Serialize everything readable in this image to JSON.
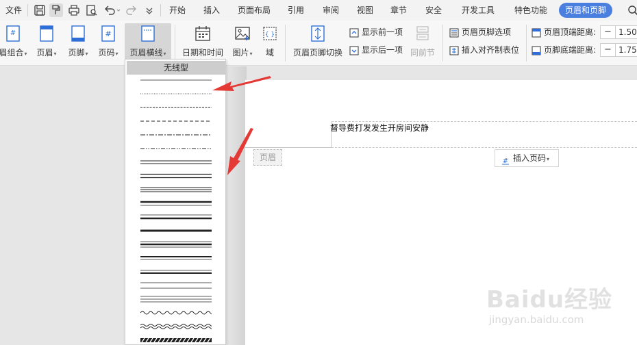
{
  "menubar": {
    "file": "文件",
    "tabs": [
      "开始",
      "插入",
      "页面布局",
      "引用",
      "审阅",
      "视图",
      "章节",
      "安全",
      "开发工具",
      "特色功能"
    ],
    "active_tab": "页眉和页脚"
  },
  "ribbon": {
    "combo": "眉组合",
    "header": "页眉",
    "footer": "页脚",
    "page_number": "页码",
    "header_line": "页眉横线",
    "datetime": "日期和时间",
    "picture": "图片",
    "field": "域",
    "switch": "页眉页脚切换",
    "show_prev": "显示前一项",
    "show_next": "显示后一项",
    "same_as_prev": "同前节",
    "hf_options": "页眉页脚选项",
    "insert_align_tab": "插入对齐制表位",
    "header_top_label": "页眉顶端距离:",
    "header_top_value": "1.50",
    "footer_bottom_label": "页脚底端距离:",
    "footer_bottom_value": "1.75"
  },
  "dropdown": {
    "title": "无线型",
    "styles": [
      "thin-solid",
      "dotted-fine",
      "dashed-fine",
      "dashed",
      "dash-dot",
      "dash-dot-dot",
      "double-thin",
      "double",
      "triple",
      "thick-thin",
      "thin-thick",
      "thick",
      "thin-thick-thin",
      "thick-thin-small",
      "thin-thick-small",
      "spaced-double",
      "triple-thin",
      "wave",
      "double-wave",
      "hatched"
    ]
  },
  "document": {
    "header_text": "督导费打发发生开房间安静",
    "header_tag": "页眉",
    "insert_page_number": "插入页码"
  },
  "watermark": {
    "brand": "Baidu经验",
    "url": "jingyan.baidu.com"
  },
  "colors": {
    "accent": "#4a7fe0",
    "arrow": "#e53935",
    "ribbon_icon": "#2d6fd6"
  }
}
